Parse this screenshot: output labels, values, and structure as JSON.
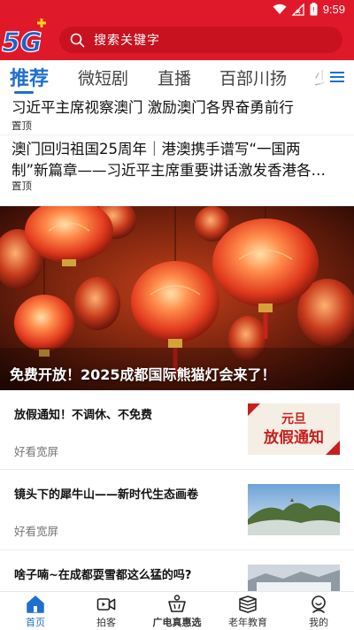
{
  "status_bar": {
    "time": "9:59",
    "icons": [
      "wifi-icon",
      "signal-icon",
      "battery-icon"
    ]
  },
  "header": {
    "logo_text": "5G",
    "search_placeholder": "搜索关键字",
    "colors": {
      "header_red": "#e0192a",
      "accent_blue": "#1f6fd0"
    }
  },
  "tabs": [
    {
      "label": "推荐",
      "active": true
    },
    {
      "label": "微短剧",
      "active": false
    },
    {
      "label": "直播",
      "active": false
    },
    {
      "label": "百部川扬",
      "active": false
    },
    {
      "label": "少",
      "active": false
    }
  ],
  "headlines": [
    {
      "title": "习近平主席视察澳门 激励澳门各界奋勇前行",
      "tag": "置顶"
    },
    {
      "title_line1": "澳门回归祖国25周年｜港澳携手谱写“一国两",
      "title_line2": "制”新篇章——习近平主席重要讲话激发香港各…",
      "tag": "置顶"
    }
  ],
  "banner": {
    "caption": "免费开放！2025成都国际熊猫灯会来了！"
  },
  "news": [
    {
      "title": "放假通知！不调休、不免费",
      "source": "好看宽屏",
      "thumb_line1": "元旦",
      "thumb_line2": "放假通知"
    },
    {
      "title": "镜头下的犀牛山——新时代生态画卷",
      "source": "好看宽屏"
    },
    {
      "title": "啥子喃~在成都耍雪都这么猛的吗?",
      "source": ""
    }
  ],
  "bottom_nav": [
    {
      "label": "首页",
      "icon": "home-icon",
      "active": true
    },
    {
      "label": "拍客",
      "icon": "video-camera-icon",
      "active": false
    },
    {
      "label": "广电真惠选",
      "icon": "shopping-basket-icon",
      "active": false,
      "bold": true
    },
    {
      "label": "老年教育",
      "icon": "books-icon",
      "active": false
    },
    {
      "label": "我的",
      "icon": "profile-icon",
      "active": false
    }
  ]
}
